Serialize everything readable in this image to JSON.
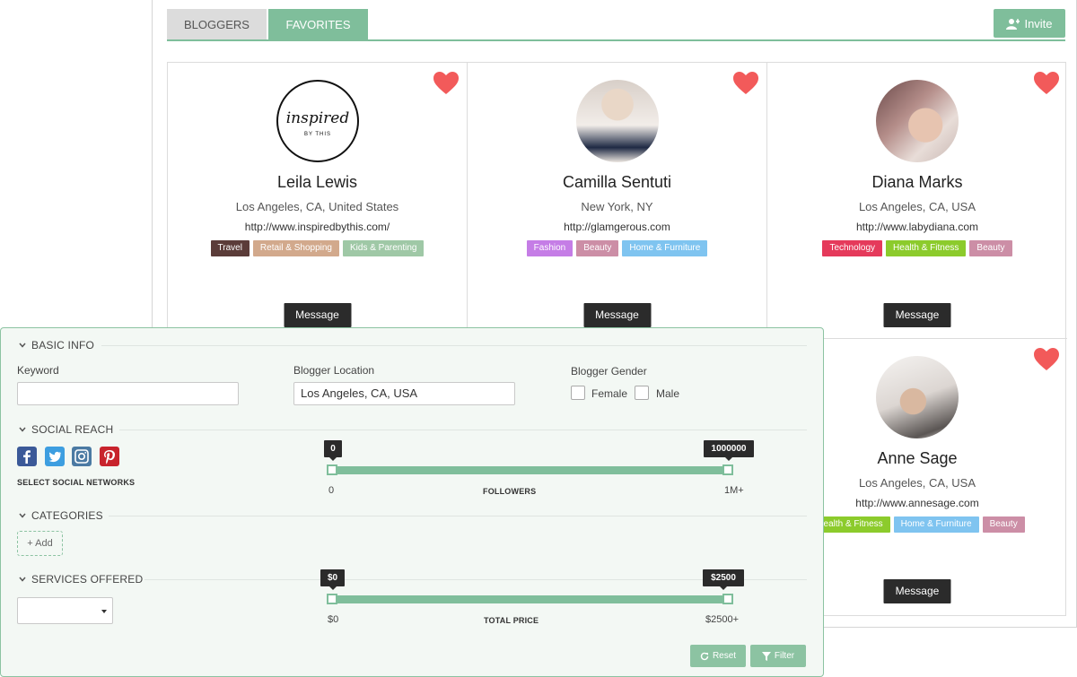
{
  "tabs": [
    {
      "label": "BLOGGERS"
    },
    {
      "label": "FAVORITES"
    }
  ],
  "invite_label": "Invite",
  "bloggers": [
    {
      "name": "Leila Lewis",
      "location": "Los Angeles, CA, United States",
      "url": "http://www.inspiredbythis.com/",
      "tags": [
        {
          "label": "Travel",
          "color": "#5b3c39"
        },
        {
          "label": "Retail & Shopping",
          "color": "#d2a98c"
        },
        {
          "label": "Kids & Parenting",
          "color": "#9fc8a6"
        }
      ],
      "logo_text": "inspired",
      "logo_sub": "BY THIS"
    },
    {
      "name": "Camilla Sentuti",
      "location": "New York, NY",
      "url": "http://glamgerous.com",
      "tags": [
        {
          "label": "Fashion",
          "color": "#c57de6"
        },
        {
          "label": "Beauty",
          "color": "#cc8ea6"
        },
        {
          "label": "Home & Furniture",
          "color": "#7fc4f0"
        }
      ]
    },
    {
      "name": "Diana Marks",
      "location": "Los Angeles, CA, USA",
      "url": "http://www.labydiana.com",
      "tags": [
        {
          "label": "Technology",
          "color": "#e53a5b"
        },
        {
          "label": "Health & Fitness",
          "color": "#8ccb2c"
        },
        {
          "label": "Beauty",
          "color": "#cc8ea6"
        }
      ]
    },
    {
      "name": "Anne Sage",
      "location": "Los Angeles, CA, USA",
      "url": "http://www.annesage.com",
      "tags": [
        {
          "label": "Health & Fitness",
          "color": "#8ccb2c"
        },
        {
          "label": "Home & Furniture",
          "color": "#7fc4f0"
        },
        {
          "label": "Beauty",
          "color": "#cc8ea6"
        }
      ]
    }
  ],
  "message_label": "Message",
  "filters": {
    "basic_info": "BASIC INFO",
    "keyword_label": "Keyword",
    "keyword_value": "",
    "location_label": "Blogger Location",
    "location_value": "Los Angeles, CA, USA",
    "gender_label": "Blogger Gender",
    "gender_female": "Female",
    "gender_male": "Male",
    "social_reach": "SOCIAL REACH",
    "select_networks": "SELECT SOCIAL NETWORKS",
    "followers_min": "0",
    "followers_max": "1000000",
    "followers_min_label": "0",
    "followers_max_label": "1M+",
    "followers_caption": "FOLLOWERS",
    "categories": "CATEGORIES",
    "add_label": "+ Add",
    "services_offered": "SERVICES OFFERED",
    "price_min": "$0",
    "price_max": "$2500",
    "price_min_label": "$0",
    "price_max_label": "$2500+",
    "price_caption": "TOTAL PRICE",
    "reset_label": "Reset",
    "filter_label": "Filter"
  },
  "colors": {
    "accent": "#7fbe9b",
    "heart": "#f25a5a",
    "dark": "#2b2b2b"
  }
}
